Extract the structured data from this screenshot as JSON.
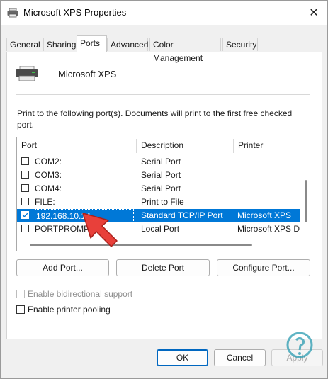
{
  "window": {
    "title": "Microsoft XPS Properties",
    "close_glyph": "✕"
  },
  "tabs": [
    {
      "label": "General"
    },
    {
      "label": "Sharing"
    },
    {
      "label": "Ports",
      "active": true
    },
    {
      "label": "Advanced"
    },
    {
      "label": "Color Management"
    },
    {
      "label": "Security"
    }
  ],
  "printer": {
    "name": "Microsoft XPS",
    "icon": "printer-icon"
  },
  "description": "Print to the following port(s). Documents will print to the first free checked port.",
  "ports_table": {
    "columns": [
      "Port",
      "Description",
      "Printer"
    ],
    "rows": [
      {
        "port": "COM2:",
        "description": "Serial Port",
        "printer": "",
        "checked": false,
        "selected": false
      },
      {
        "port": "COM3:",
        "description": "Serial Port",
        "printer": "",
        "checked": false,
        "selected": false
      },
      {
        "port": "COM4:",
        "description": "Serial Port",
        "printer": "",
        "checked": false,
        "selected": false
      },
      {
        "port": "FILE:",
        "description": "Print to File",
        "printer": "",
        "checked": false,
        "selected": false
      },
      {
        "port": "192.168.10.14",
        "description": "Standard TCP/IP Port",
        "printer": "Microsoft XPS",
        "checked": true,
        "selected": true
      },
      {
        "port": "PORTPROMPT:",
        "description": "Local Port",
        "printer": "Microsoft XPS D",
        "checked": false,
        "selected": false
      }
    ]
  },
  "buttons": {
    "add_port": "Add Port...",
    "delete_port": "Delete Port",
    "configure_port": "Configure Port..."
  },
  "options": {
    "bidirectional": {
      "label": "Enable bidirectional support",
      "checked": false,
      "enabled": false
    },
    "pooling": {
      "label": "Enable printer pooling",
      "checked": false,
      "enabled": true
    }
  },
  "footer": {
    "ok": "OK",
    "cancel": "Cancel",
    "apply": "Apply"
  },
  "colors": {
    "selection": "#0078d7",
    "arrow": "#e8403a",
    "logo": "#2a9bb0"
  }
}
